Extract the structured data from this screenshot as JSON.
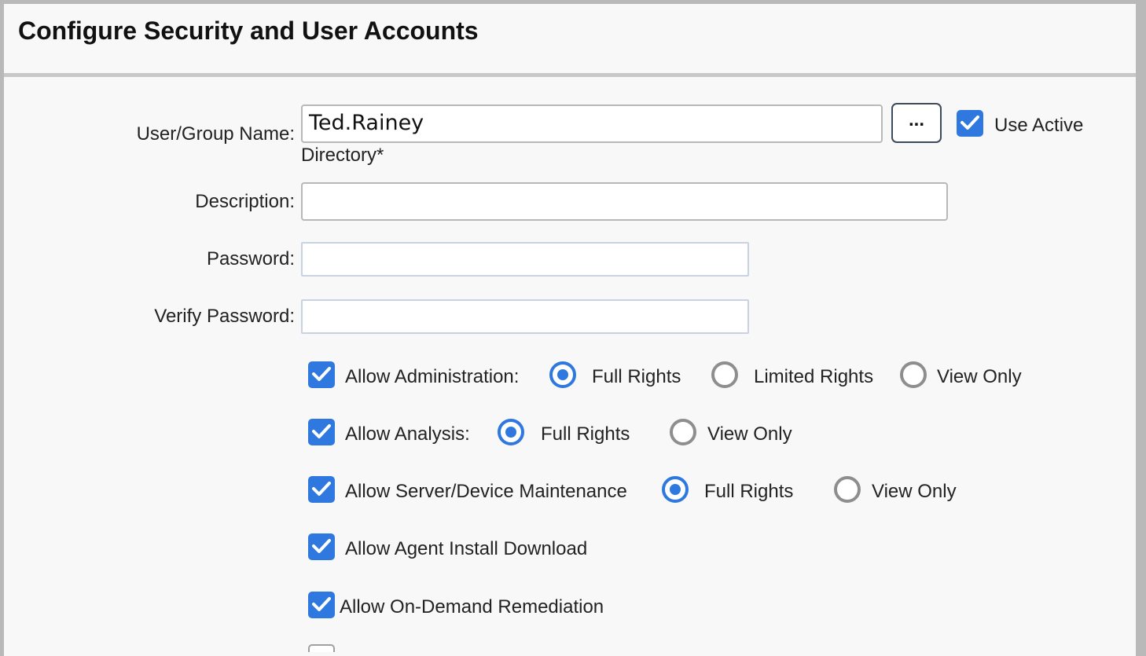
{
  "header": {
    "title": "Configure Security and User Accounts"
  },
  "form": {
    "user_group": {
      "label": "User/Group Name:",
      "value": "Ted.Rainey",
      "browse_label": "...",
      "use_ad_label": "Use Active",
      "use_ad_label_wrap": "Directory*",
      "use_ad_checked": true
    },
    "description": {
      "label": "Description:",
      "value": ""
    },
    "password": {
      "label": "Password:",
      "value": ""
    },
    "verify_password": {
      "label": "Verify Password:",
      "value": ""
    }
  },
  "permissions": {
    "administration": {
      "label": "Allow Administration:",
      "checked": true,
      "options": [
        "Full Rights",
        "Limited Rights",
        "View Only"
      ],
      "selected": "Full Rights"
    },
    "analysis": {
      "label": "Allow Analysis:",
      "checked": true,
      "options": [
        "Full Rights",
        "View Only"
      ],
      "selected": "Full Rights"
    },
    "maintenance": {
      "label": "Allow Server/Device Maintenance",
      "checked": true,
      "options": [
        "Full Rights",
        "View Only"
      ],
      "selected": "Full Rights"
    },
    "agent_download": {
      "label": "Allow Agent Install Download",
      "checked": true
    },
    "remediation": {
      "label": "Allow On-Demand Remediation",
      "checked": true
    }
  },
  "colors": {
    "accent": "#2e78e0",
    "radio_off": "#8e8e8e"
  }
}
